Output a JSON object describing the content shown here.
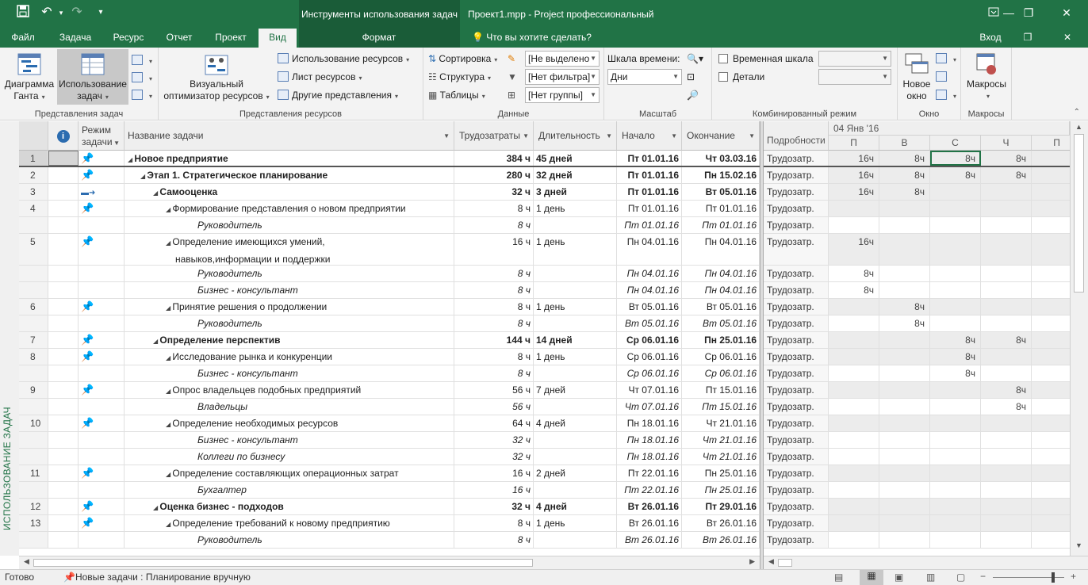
{
  "window": {
    "context_title": "Инструменты использования задач",
    "app_title": "Проект1.mpp - Project профессиональный",
    "quick_access": [
      "save-icon",
      "undo-icon",
      "redo-icon",
      "customize-icon"
    ],
    "controls": {
      "minimize": "—",
      "restore": "❐",
      "close": "✕"
    }
  },
  "tabs": [
    "Файл",
    "Задача",
    "Ресурс",
    "Отчет",
    "Проект",
    "Вид",
    "Формат"
  ],
  "active_tab": "Вид",
  "tell_me": "Что вы хотите сделать?",
  "signin": "Вход",
  "ribbon": {
    "task_views": {
      "label": "Представления задач",
      "gantt": "Диаграмма Ганта",
      "usage": "Использование задач"
    },
    "resource_views": {
      "label": "Представления ресурсов",
      "team_planner": "Визуальный оптимизатор ресурсов",
      "resource_usage": "Использование ресурсов",
      "resource_sheet": "Лист ресурсов",
      "other_views": "Другие представления"
    },
    "data": {
      "label": "Данные",
      "sort": "Сортировка",
      "outline": "Структура",
      "tables": "Таблицы",
      "highlight": "[Не выделено",
      "filter": "[Нет фильтра]",
      "group": "[Нет группы]"
    },
    "zoom": {
      "label": "Масштаб",
      "timescale": "Шкала времени:",
      "timescale_value": "Дни"
    },
    "split_view": {
      "label": "Комбинированный режим",
      "timeline": "Временная шкала",
      "details": "Детали"
    },
    "window": {
      "label": "Окно",
      "new_window": "Новое окно"
    },
    "macros": {
      "label": "Макросы",
      "macros": "Макросы"
    }
  },
  "view_label": "ИСПОЛЬЗОВАНИЕ ЗАДАЧ",
  "columns": {
    "info": "i",
    "mode": "Режим задачи",
    "name": "Название задачи",
    "work": "Трудозатраты",
    "duration": "Длительность",
    "start": "Начало",
    "finish": "Окончание"
  },
  "rows": [
    {
      "id": "1",
      "mode": "pin",
      "name": "Новое предприятие",
      "work": "384 ч",
      "duration": "45 дней",
      "start": "Пт 01.01.16",
      "finish": "Чт 03.03.16",
      "level": 0,
      "type": "summary",
      "usage": [
        "16ч",
        "8ч",
        "8ч",
        "8ч"
      ]
    },
    {
      "id": "2",
      "mode": "pin",
      "name": "Этап 1. Стратегическое планирование",
      "work": "280 ч",
      "duration": "32 дней",
      "start": "Пт 01.01.16",
      "finish": "Пн 15.02.16",
      "level": 1,
      "type": "summary",
      "usage": [
        "16ч",
        "8ч",
        "8ч",
        "8ч"
      ]
    },
    {
      "id": "3",
      "mode": "auto",
      "name": "Самооценка",
      "work": "32 ч",
      "duration": "3 дней",
      "start": "Пт 01.01.16",
      "finish": "Вт 05.01.16",
      "level": 2,
      "type": "summary",
      "usage": [
        "16ч",
        "8ч",
        "",
        ""
      ]
    },
    {
      "id": "4",
      "mode": "pin",
      "name": "Формирование представления о новом предприятии",
      "work": "8 ч",
      "duration": "1 день",
      "start": "Пт 01.01.16",
      "finish": "Пт 01.01.16",
      "level": 3,
      "type": "task",
      "usage": [
        "",
        "",
        "",
        ""
      ]
    },
    {
      "id": "",
      "mode": "",
      "name": "Руководитель",
      "work": "8 ч",
      "duration": "",
      "start": "Пт 01.01.16",
      "finish": "Пт 01.01.16",
      "level": 4,
      "type": "assign",
      "usage": [
        "",
        "",
        "",
        ""
      ]
    },
    {
      "id": "5",
      "mode": "pin",
      "name": "Определение имеющихся умений,",
      "name2": "навыков,информации и поддержки",
      "work": "16 ч",
      "duration": "1 день",
      "start": "Пн 04.01.16",
      "finish": "Пн 04.01.16",
      "level": 3,
      "type": "task",
      "tall": true,
      "usage": [
        "16ч",
        "",
        "",
        ""
      ]
    },
    {
      "id": "",
      "mode": "",
      "name": "Руководитель",
      "work": "8 ч",
      "duration": "",
      "start": "Пн 04.01.16",
      "finish": "Пн 04.01.16",
      "level": 4,
      "type": "assign",
      "usage": [
        "8ч",
        "",
        "",
        ""
      ]
    },
    {
      "id": "",
      "mode": "",
      "name": "Бизнес - консультант",
      "work": "8 ч",
      "duration": "",
      "start": "Пн 04.01.16",
      "finish": "Пн 04.01.16",
      "level": 4,
      "type": "assign",
      "usage": [
        "8ч",
        "",
        "",
        ""
      ]
    },
    {
      "id": "6",
      "mode": "pin",
      "name": "Принятие решения о продолжении",
      "work": "8 ч",
      "duration": "1 день",
      "start": "Вт 05.01.16",
      "finish": "Вт 05.01.16",
      "level": 3,
      "type": "task",
      "usage": [
        "",
        "8ч",
        "",
        ""
      ]
    },
    {
      "id": "",
      "mode": "",
      "name": "Руководитель",
      "work": "8 ч",
      "duration": "",
      "start": "Вт 05.01.16",
      "finish": "Вт 05.01.16",
      "level": 4,
      "type": "assign",
      "usage": [
        "",
        "8ч",
        "",
        ""
      ]
    },
    {
      "id": "7",
      "mode": "pin",
      "name": "Определение перспектив",
      "work": "144 ч",
      "duration": "14 дней",
      "start": "Ср 06.01.16",
      "finish": "Пн 25.01.16",
      "level": 2,
      "type": "summary",
      "usage": [
        "",
        "",
        "8ч",
        "8ч"
      ]
    },
    {
      "id": "8",
      "mode": "pin",
      "name": "Исследование рынка и конкуренции",
      "work": "8 ч",
      "duration": "1 день",
      "start": "Ср 06.01.16",
      "finish": "Ср 06.01.16",
      "level": 3,
      "type": "task",
      "usage": [
        "",
        "",
        "8ч",
        ""
      ]
    },
    {
      "id": "",
      "mode": "",
      "name": "Бизнес - консультант",
      "work": "8 ч",
      "duration": "",
      "start": "Ср 06.01.16",
      "finish": "Ср 06.01.16",
      "level": 4,
      "type": "assign",
      "usage": [
        "",
        "",
        "8ч",
        ""
      ]
    },
    {
      "id": "9",
      "mode": "pin",
      "name": "Опрос владельцев подобных предприятий",
      "work": "56 ч",
      "duration": "7 дней",
      "start": "Чт 07.01.16",
      "finish": "Пт 15.01.16",
      "level": 3,
      "type": "task",
      "usage": [
        "",
        "",
        "",
        "8ч"
      ]
    },
    {
      "id": "",
      "mode": "",
      "name": "Владельцы",
      "work": "56 ч",
      "duration": "",
      "start": "Чт 07.01.16",
      "finish": "Пт 15.01.16",
      "level": 4,
      "type": "assign",
      "usage": [
        "",
        "",
        "",
        "8ч"
      ]
    },
    {
      "id": "10",
      "mode": "pin",
      "name": "Определение необходимых ресурсов",
      "work": "64 ч",
      "duration": "4 дней",
      "start": "Пн 18.01.16",
      "finish": "Чт 21.01.16",
      "level": 3,
      "type": "task",
      "usage": [
        "",
        "",
        "",
        ""
      ]
    },
    {
      "id": "",
      "mode": "",
      "name": "Бизнес - консультант",
      "work": "32 ч",
      "duration": "",
      "start": "Пн 18.01.16",
      "finish": "Чт 21.01.16",
      "level": 4,
      "type": "assign",
      "usage": [
        "",
        "",
        "",
        ""
      ]
    },
    {
      "id": "",
      "mode": "",
      "name": "Коллеги по бизнесу",
      "work": "32 ч",
      "duration": "",
      "start": "Пн 18.01.16",
      "finish": "Чт 21.01.16",
      "level": 4,
      "type": "assign",
      "usage": [
        "",
        "",
        "",
        ""
      ]
    },
    {
      "id": "11",
      "mode": "pin",
      "name": "Определение составляющих операционных затрат",
      "work": "16 ч",
      "duration": "2 дней",
      "start": "Пт 22.01.16",
      "finish": "Пн 25.01.16",
      "level": 3,
      "type": "task",
      "usage": [
        "",
        "",
        "",
        ""
      ]
    },
    {
      "id": "",
      "mode": "",
      "name": "Бухгалтер",
      "work": "16 ч",
      "duration": "",
      "start": "Пт 22.01.16",
      "finish": "Пн 25.01.16",
      "level": 4,
      "type": "assign",
      "usage": [
        "",
        "",
        "",
        ""
      ]
    },
    {
      "id": "12",
      "mode": "pin",
      "name": "Оценка бизнес - подходов",
      "work": "32 ч",
      "duration": "4 дней",
      "start": "Вт 26.01.16",
      "finish": "Пт 29.01.16",
      "level": 2,
      "type": "summary",
      "usage": [
        "",
        "",
        "",
        ""
      ]
    },
    {
      "id": "13",
      "mode": "pin",
      "name": "Определение требований к новому предприятию",
      "work": "8 ч",
      "duration": "1 день",
      "start": "Вт 26.01.16",
      "finish": "Вт 26.01.16",
      "level": 3,
      "type": "task",
      "usage": [
        "",
        "",
        "",
        ""
      ]
    },
    {
      "id": "",
      "mode": "",
      "name": "Руководитель",
      "work": "8 ч",
      "duration": "",
      "start": "Вт 26.01.16",
      "finish": "Вт 26.01.16",
      "level": 4,
      "type": "assign",
      "usage": [
        "",
        "",
        "",
        ""
      ]
    }
  ],
  "usage": {
    "details_header": "Подробности",
    "week_label": "04 Янв '16",
    "days": [
      "П",
      "В",
      "С",
      "Ч",
      "П"
    ],
    "detail_label": "Трудозатр."
  },
  "status": {
    "ready": "Готово",
    "new_tasks": "Новые задачи : Планирование вручную"
  },
  "colors": {
    "accent": "#217346",
    "context": "#1a5c38",
    "pin": "#3a9fd8"
  }
}
